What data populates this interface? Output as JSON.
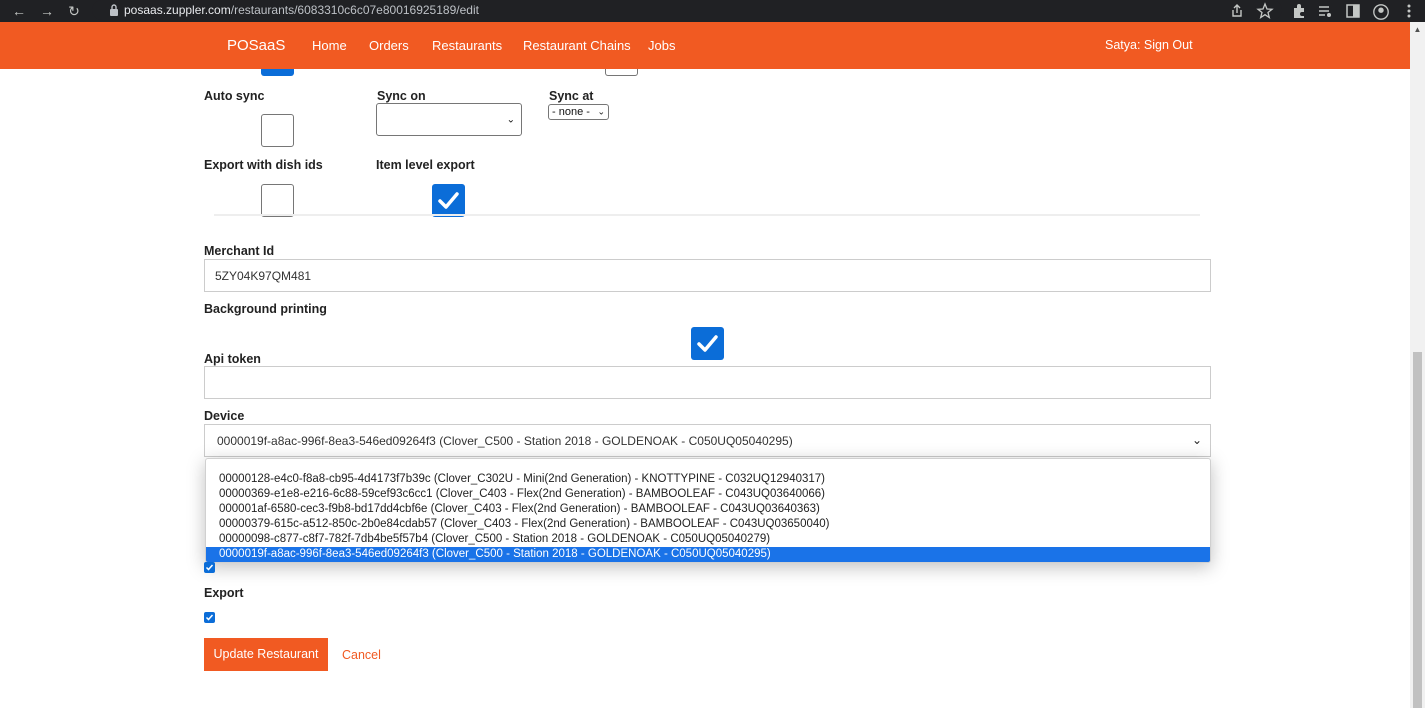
{
  "browser": {
    "url_host": "posaas.zuppler.com",
    "url_path": "/restaurants/6083310c6c07e80016925189/edit",
    "back_glyph": "←",
    "forward_glyph": "→",
    "reload_glyph": "↻"
  },
  "navbar": {
    "brand": "POSaaS",
    "links": [
      "Home",
      "Orders",
      "Restaurants",
      "Restaurant Chains",
      "Jobs"
    ],
    "user": "Satya: Sign Out",
    "color": "#f15a22"
  },
  "form": {
    "auto_sync_label": "Auto sync",
    "auto_sync_checked": false,
    "sync_on_label": "Sync on",
    "sync_on_value": "",
    "sync_at_label": "Sync at",
    "sync_at_value": "- none -",
    "export_dish_ids_label": "Export with dish ids",
    "export_dish_ids_checked": false,
    "item_level_export_label": "Item level export",
    "item_level_export_checked": true,
    "merchant_id_label": "Merchant Id",
    "merchant_id_value": "5ZY04K97QM481",
    "background_printing_label": "Background printing",
    "background_printing_checked": true,
    "api_token_label": "Api token",
    "api_token_value": "",
    "device_label": "Device",
    "device_value": "0000019f-a8ac-996f-8ea3-546ed09264f3 (Clover_C500 - Station 2018 - GOLDENOAK - C050UQ05040295)",
    "device_options": [
      "00000128-e4c0-f8a8-cb95-4d4173f7b39c (Clover_C302U - Mini(2nd Generation) - KNOTTYPINE - C032UQ12940317)",
      "00000369-e1e8-e216-6c88-59cef93c6cc1 (Clover_C403 - Flex(2nd Generation) - BAMBOOLEAF - C043UQ03640066)",
      "000001af-6580-cec3-f9b8-bd17dd4cbf6e (Clover_C403 - Flex(2nd Generation) - BAMBOOLEAF - C043UQ03640363)",
      "00000379-615c-a512-850c-2b0e84cdab57 (Clover_C403 - Flex(2nd Generation) - BAMBOOLEAF - C043UQ03650040)",
      "00000098-c877-c8f7-782f-7db4be5f57b4 (Clover_C500 - Station 2018 - GOLDENOAK - C050UQ05040279)",
      "0000019f-a8ac-996f-8ea3-546ed09264f3 (Clover_C500 - Station 2018 - GOLDENOAK - C050UQ05040295)"
    ],
    "selected_option_index": 5,
    "hidden_checkbox_checked": true,
    "export_label": "Export",
    "export_checked": true,
    "update_button": "Update Restaurant",
    "cancel_link": "Cancel"
  }
}
